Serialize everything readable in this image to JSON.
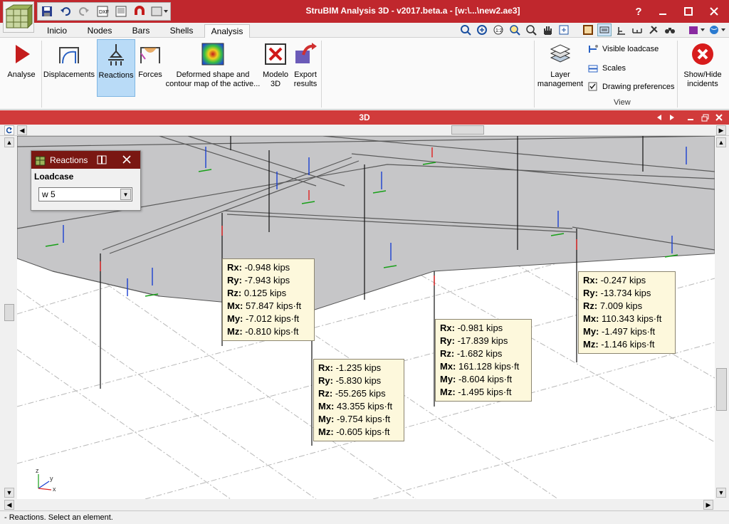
{
  "window": {
    "title": "StruBIM Analysis 3D - v2017.beta.a - [w:\\...\\new2.ae3]",
    "help_label": "?",
    "titlebar_color": "#c0272d"
  },
  "qat": {
    "icons": [
      "save-icon",
      "undo-icon",
      "redo-icon",
      "export-icon",
      "import-icon",
      "magnet-icon",
      "view-dropdown-icon"
    ]
  },
  "tabs": [
    {
      "label": "Inicio"
    },
    {
      "label": "Nodes"
    },
    {
      "label": "Bars"
    },
    {
      "label": "Shells"
    },
    {
      "label": "Analysis"
    }
  ],
  "ribbon": {
    "analyse": "Analyse",
    "displacements": "Displacements",
    "reactions": "Reactions",
    "forces": "Forces",
    "deformed_line1": "Deformed shape and",
    "deformed_line2": "contour map of the active...",
    "modelo_line1": "Modelo",
    "modelo_line2": "3D",
    "export_line1": "Export",
    "export_line2": "results",
    "layer_line1": "Layer",
    "layer_line2": "management",
    "visible_loadcase": "Visible loadcase",
    "scales": "Scales",
    "drawing_preferences": "Drawing preferences",
    "show_line1": "Show/Hide",
    "show_line2": "incidents",
    "view_group": "View"
  },
  "view3d": {
    "title": "3D",
    "accent": "#d13b3b"
  },
  "reactions_panel": {
    "title": "Reactions",
    "loadcase_label": "Loadcase",
    "loadcase_value": "w 5"
  },
  "tooltips": [
    {
      "lines": [
        {
          "k": "Rx:",
          "v": "-0.948 kips"
        },
        {
          "k": "Ry:",
          "v": "-7.943 kips"
        },
        {
          "k": "Rz:",
          "v": "0.125 kips"
        },
        {
          "k": "Mx:",
          "v": "57.847 kips·ft"
        },
        {
          "k": "My:",
          "v": "-7.012 kips·ft"
        },
        {
          "k": "Mz:",
          "v": "-0.810 kips·ft"
        }
      ]
    },
    {
      "lines": [
        {
          "k": "Rx:",
          "v": "-1.235 kips"
        },
        {
          "k": "Ry:",
          "v": "-5.830 kips"
        },
        {
          "k": "Rz:",
          "v": "-55.265 kips"
        },
        {
          "k": "Mx:",
          "v": "43.355 kips·ft"
        },
        {
          "k": "My:",
          "v": "-9.754 kips·ft"
        },
        {
          "k": "Mz:",
          "v": "-0.605 kips·ft"
        }
      ]
    },
    {
      "lines": [
        {
          "k": "Rx:",
          "v": "-0.981 kips"
        },
        {
          "k": "Ry:",
          "v": "-17.839 kips"
        },
        {
          "k": "Rz:",
          "v": "-1.682 kips"
        },
        {
          "k": "Mx:",
          "v": "161.128 kips·ft"
        },
        {
          "k": "My:",
          "v": "-8.604 kips·ft"
        },
        {
          "k": "Mz:",
          "v": "-1.495 kips·ft"
        }
      ]
    },
    {
      "lines": [
        {
          "k": "Rx:",
          "v": "-0.247 kips"
        },
        {
          "k": "Ry:",
          "v": "-13.734 kips"
        },
        {
          "k": "Rz:",
          "v": "7.009 kips"
        },
        {
          "k": "Mx:",
          "v": "110.343 kips·ft"
        },
        {
          "k": "My:",
          "v": "-1.497 kips·ft"
        },
        {
          "k": "Mz:",
          "v": "-1.146 kips·ft"
        }
      ]
    }
  ],
  "axis_labels": {
    "z": "z",
    "y": "y",
    "x": "x"
  },
  "status": {
    "text": "- Reactions.  Select an element."
  }
}
